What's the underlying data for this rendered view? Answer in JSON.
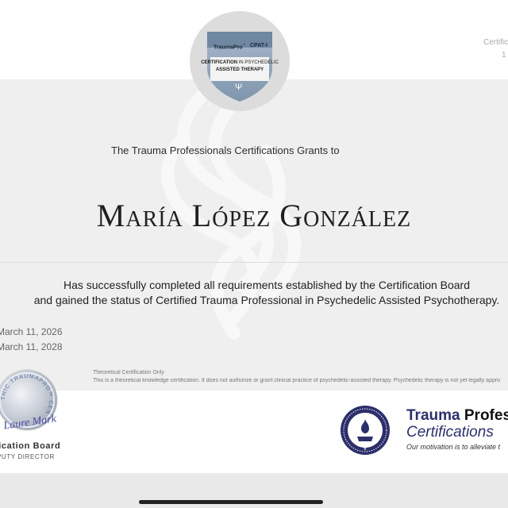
{
  "badge": {
    "brand": "TraumaPro",
    "brand_mark": "™",
    "code": "CPAT-I",
    "line1_a": "CERTIFICATION",
    "line1_b": " IN PSYCHEDELIC",
    "line2": "ASSISTED THERAPY",
    "symbol": "Ψ",
    "colors": {
      "shield": "#8fa3b8",
      "shield_dark": "#5d7590",
      "circle": "#dcdcdc"
    }
  },
  "top_right": {
    "line1": "Certific",
    "line2": "1"
  },
  "certificate": {
    "grant_line": "The Trauma Professionals Certifications Grants to",
    "recipient": "María López González",
    "statement_line1": "Has successfully completed all requirements established by the Certification Board",
    "statement_line2": "and gained the status of Certified Trauma Professional in Psychedelic Assisted Psychotherapy.",
    "date_issued": "March 11, 2026",
    "date_expires": "March 11, 2028",
    "disclaimer_title": "Theoretical Certification Only",
    "disclaimer_text": "This is a theoretical knowledge certification. It does not authorize or grant clinical practice of psychedelic-assisted therapy. Psychedelic therapy is not yet legally appro"
  },
  "seal": {
    "text": "THIC TRAUMAPRO™ CER",
    "signature": "Laure Markie"
  },
  "signatory": {
    "title": "fication Board",
    "role": "PUTY DIRECTOR"
  },
  "organization": {
    "name_part1": "Trauma",
    "name_part2": " Profes",
    "subtitle": "Certifications",
    "tagline": "Our motivation is to alleviate t",
    "colors": {
      "navy": "#2c2f6b",
      "accent": "#4a5aa8"
    }
  }
}
